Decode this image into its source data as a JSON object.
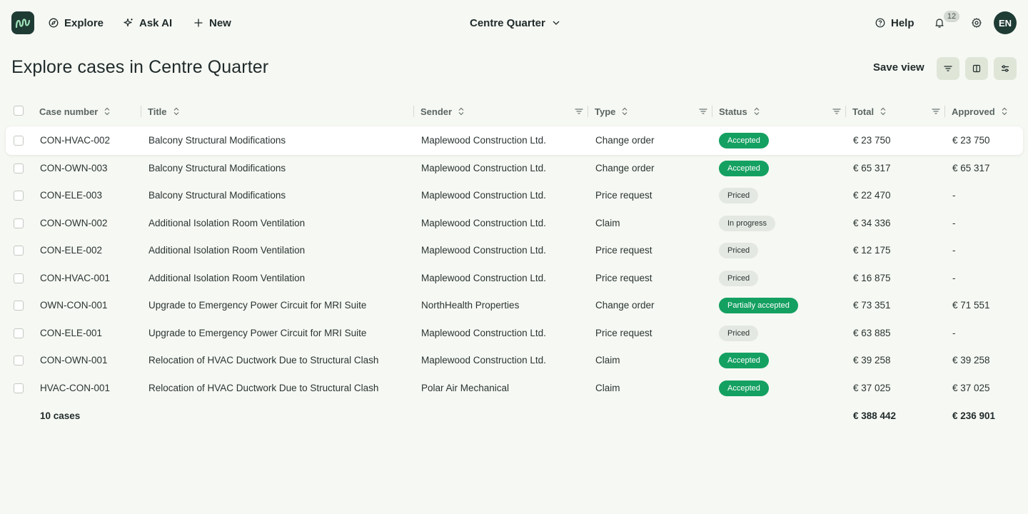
{
  "nav": {
    "explore": "Explore",
    "ask_ai": "Ask AI",
    "new": "New",
    "project": "Centre Quarter",
    "help": "Help",
    "notifications_count": "12",
    "avatar_initials": "EN"
  },
  "page": {
    "title": "Explore cases in Centre Quarter",
    "save_view": "Save view"
  },
  "table": {
    "columns": [
      "Case number",
      "Title",
      "Sender",
      "Type",
      "Status",
      "Total",
      "Approved"
    ],
    "rows": [
      {
        "case": "CON-HVAC-002",
        "title": "Balcony Structural Modifications",
        "sender": "Maplewood Construction Ltd.",
        "type": "Change order",
        "status": "Accepted",
        "total": "€ 23 750",
        "approved": "€ 23 750"
      },
      {
        "case": "CON-OWN-003",
        "title": "Balcony Structural Modifications",
        "sender": "Maplewood Construction Ltd.",
        "type": "Change order",
        "status": "Accepted",
        "total": "€ 65 317",
        "approved": "€ 65 317"
      },
      {
        "case": "CON-ELE-003",
        "title": "Balcony Structural Modifications",
        "sender": "Maplewood Construction Ltd.",
        "type": "Price request",
        "status": "Priced",
        "total": "€ 22 470",
        "approved": "-"
      },
      {
        "case": "CON-OWN-002",
        "title": "Additional Isolation Room Ventilation",
        "sender": "Maplewood Construction Ltd.",
        "type": "Claim",
        "status": "In progress",
        "total": "€ 34 336",
        "approved": "-"
      },
      {
        "case": "CON-ELE-002",
        "title": "Additional Isolation Room Ventilation",
        "sender": "Maplewood Construction Ltd.",
        "type": "Price request",
        "status": "Priced",
        "total": "€ 12 175",
        "approved": "-"
      },
      {
        "case": "CON-HVAC-001",
        "title": "Additional Isolation Room Ventilation",
        "sender": "Maplewood Construction Ltd.",
        "type": "Price request",
        "status": "Priced",
        "total": "€ 16 875",
        "approved": "-"
      },
      {
        "case": "OWN-CON-001",
        "title": "Upgrade to Emergency Power Circuit for MRI Suite",
        "sender": "NorthHealth Properties",
        "type": "Change order",
        "status": "Partially accepted",
        "total": "€ 73 351",
        "approved": "€ 71 551"
      },
      {
        "case": "CON-ELE-001",
        "title": "Upgrade to Emergency Power Circuit for MRI Suite",
        "sender": "Maplewood Construction Ltd.",
        "type": "Price request",
        "status": "Priced",
        "total": "€ 63 885",
        "approved": "-"
      },
      {
        "case": "CON-OWN-001",
        "title": "Relocation of HVAC Ductwork Due to Structural Clash",
        "sender": "Maplewood Construction Ltd.",
        "type": "Claim",
        "status": "Accepted",
        "total": "€ 39 258",
        "approved": "€ 39 258"
      },
      {
        "case": "HVAC-CON-001",
        "title": "Relocation of HVAC Ductwork Due to Structural Clash",
        "sender": "Polar Air Mechanical",
        "type": "Claim",
        "status": "Accepted",
        "total": "€ 37 025",
        "approved": "€ 37 025"
      }
    ],
    "footer": {
      "count": "10 cases",
      "total": "€ 388 442",
      "approved": "€ 236 901"
    }
  },
  "colors": {
    "accepted": "#14a061",
    "neutral_badge": "#e4e8e2",
    "brand": "#1e3b34"
  }
}
